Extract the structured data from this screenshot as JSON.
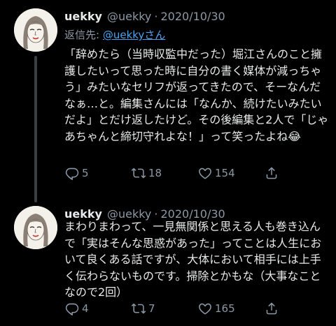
{
  "tweets": [
    {
      "name": "uekky",
      "handle": "@uekky",
      "separator": "·",
      "date": "2020/10/30",
      "reply_prefix": "返信先:",
      "reply_mention": "@uekkyさん",
      "text": "「辞めたら（当時収監中だった）堀江さんのこと擁護したいって思った時に自分の書く媒体が減っちゃう」みたいなセリフが返ってきたので、そーなんだなぁ…と。編集さんには「なんか、続けたいみたいだよ」とだけ返したけど。その後編集と2人で「じゃあちゃんと締切守れよな！」って笑ったよね😂",
      "replies": "5",
      "retweets": "18",
      "likes": "154"
    },
    {
      "name": "uekky",
      "handle": "@uekky",
      "separator": "·",
      "date": "2020/10/30",
      "text": "まわりまわって、一見無関係と思える人も巻き込んで「実はそんな思惑があった」ってことは人生において良くある話ですが、大体において相手には上手く伝わらないものです。掃除とかもな（大事なことなので2回）",
      "replies": "4",
      "retweets": "7",
      "likes": "165"
    }
  ],
  "icons": [
    "avatar",
    "reply-icon",
    "retweet-icon",
    "like-icon",
    "share-icon"
  ],
  "colors": {
    "background": "#000000",
    "text": "#e7e9ea",
    "secondary": "#8b98a5",
    "link": "#4aa3ef",
    "thread_line": "#3a3d41"
  }
}
